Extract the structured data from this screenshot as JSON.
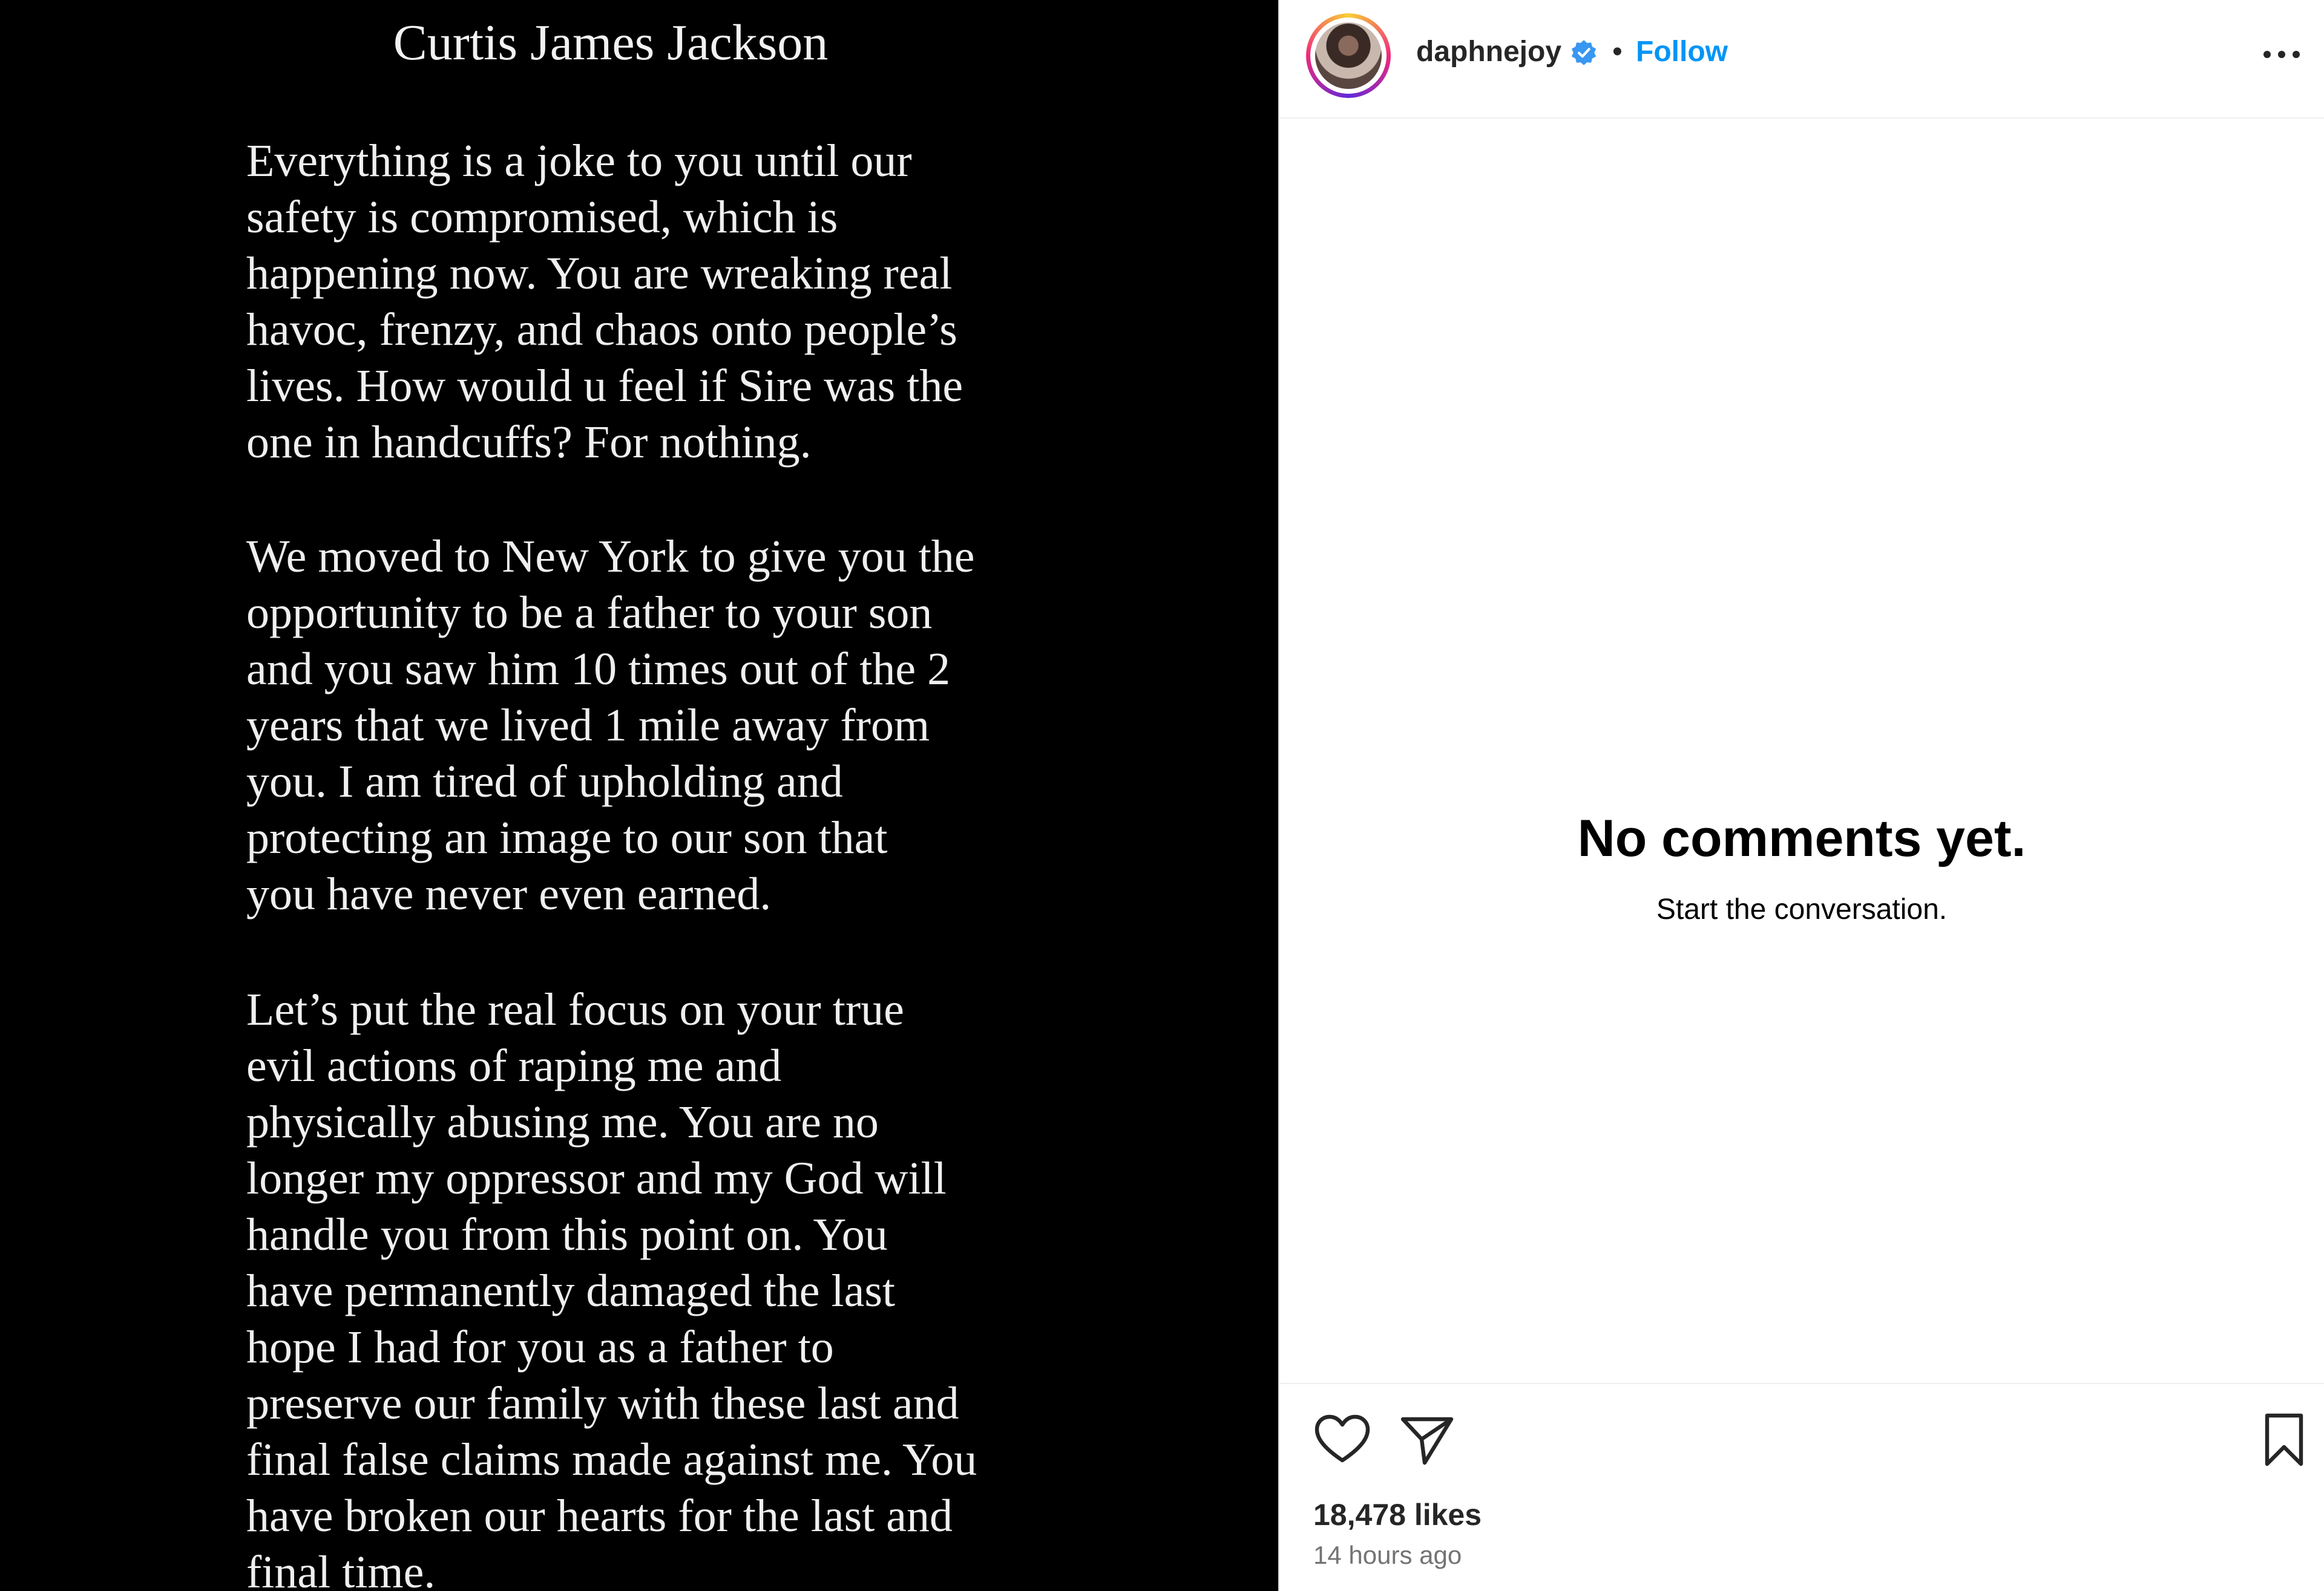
{
  "post": {
    "image_text": {
      "title": "Curtis James Jackson",
      "paragraphs": [
        [
          "Everything is a joke to you until our",
          "safety is compromised, which is",
          "happening now. You are wreaking real",
          "havoc, frenzy, and chaos onto people’s",
          "lives. How would u feel if Sire was the",
          "one in handcuffs? For nothing."
        ],
        [
          "We moved to New York to give you the",
          "opportunity to be a father to your son",
          "and you saw him 10 times out of the 2",
          "years that we lived 1 mile away from",
          "you. I am tired of upholding and",
          "protecting an image to our son that",
          "you have never even earned."
        ],
        [
          "Let’s put the real focus on your true",
          "evil actions of raping me and",
          "physically abusing me. You are no",
          "longer my oppressor and my God will",
          "handle you from this point on. You",
          "have permanently damaged the last",
          "hope I had for you as a father to",
          "preserve our family with these last and",
          "final false claims made against me. You",
          "have broken our hearts for the last and",
          "final time."
        ]
      ]
    }
  },
  "header": {
    "username": "daphnejoy",
    "separator": "•",
    "follow_label": "Follow",
    "verified_icon": "verified-badge-icon",
    "more_icon": "more-options-icon"
  },
  "comments": {
    "empty_title": "No comments yet.",
    "empty_subtitle": "Start the conversation."
  },
  "actions": {
    "like_icon": "heart-icon",
    "share_icon": "paper-plane-icon",
    "save_icon": "bookmark-icon",
    "likes_text": "18,478 likes",
    "timestamp": "14 hours ago"
  },
  "colors": {
    "accent": "#0095f6",
    "verified": "#3897f0",
    "image_background": "#000000",
    "muted_text": "#737373"
  }
}
